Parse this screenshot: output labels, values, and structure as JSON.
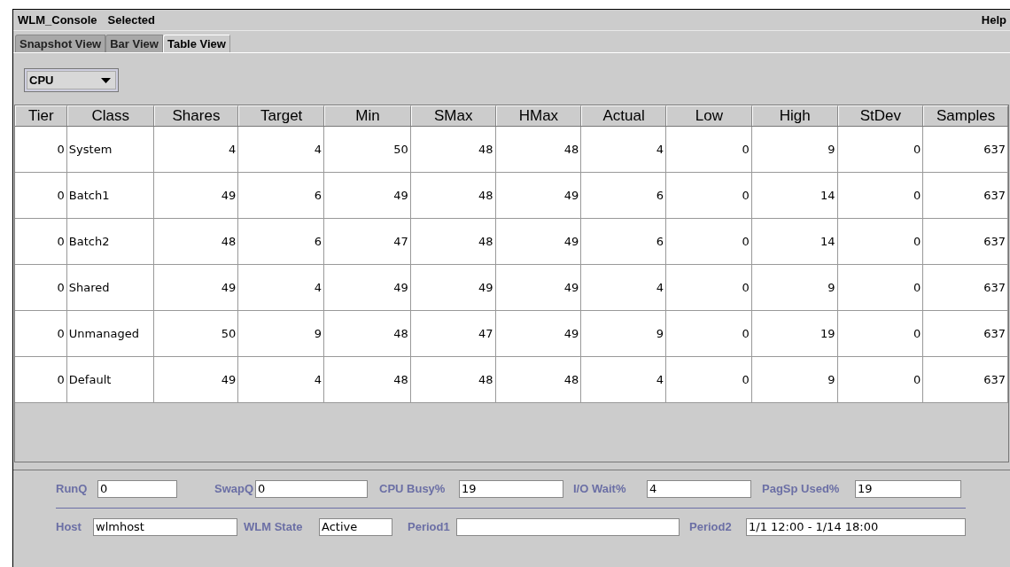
{
  "menu_bar": {
    "items": [
      "WLM_Console",
      "Selected"
    ],
    "help": "Help"
  },
  "tabs": [
    {
      "label": "Snapshot View",
      "selected": false
    },
    {
      "label": "Bar View",
      "selected": false
    },
    {
      "label": "Table View",
      "selected": true
    }
  ],
  "resource_select": {
    "value": "CPU"
  },
  "table": {
    "columns": [
      "Tier",
      "Class",
      "Shares",
      "Target",
      "Min",
      "SMax",
      "HMax",
      "Actual",
      "Low",
      "High",
      "StDev",
      "Samples"
    ],
    "rows": [
      [
        "0",
        "System",
        "4",
        "4",
        "50",
        "48",
        "48",
        "4",
        "0",
        "9",
        "0",
        "637"
      ],
      [
        "0",
        "Batch1",
        "49",
        "6",
        "49",
        "48",
        "49",
        "6",
        "0",
        "14",
        "0",
        "637"
      ],
      [
        "0",
        "Batch2",
        "48",
        "6",
        "47",
        "48",
        "49",
        "6",
        "0",
        "14",
        "0",
        "637"
      ],
      [
        "0",
        "Shared",
        "49",
        "4",
        "49",
        "49",
        "49",
        "4",
        "0",
        "9",
        "0",
        "637"
      ],
      [
        "0",
        "Unmanaged",
        "50",
        "9",
        "48",
        "47",
        "49",
        "9",
        "0",
        "19",
        "0",
        "637"
      ],
      [
        "0",
        "Default",
        "49",
        "4",
        "48",
        "48",
        "48",
        "4",
        "0",
        "9",
        "0",
        "637"
      ]
    ]
  },
  "stats": [
    {
      "label": "RunQ",
      "value": "0"
    },
    {
      "label": "SwapQ",
      "value": "0"
    },
    {
      "label": "CPU Busy%",
      "value": "19"
    },
    {
      "label": "I/O Wait%",
      "value": "4"
    },
    {
      "label": "PagSp Used%",
      "value": "19"
    }
  ],
  "info": [
    {
      "label": "Host",
      "value": "wlmhost"
    },
    {
      "label": "WLM State",
      "value": "Active"
    },
    {
      "label": "Period1"
    },
    {
      "label": "Period2",
      "value": "1/1 12:00 - 1/14 18:00"
    }
  ]
}
